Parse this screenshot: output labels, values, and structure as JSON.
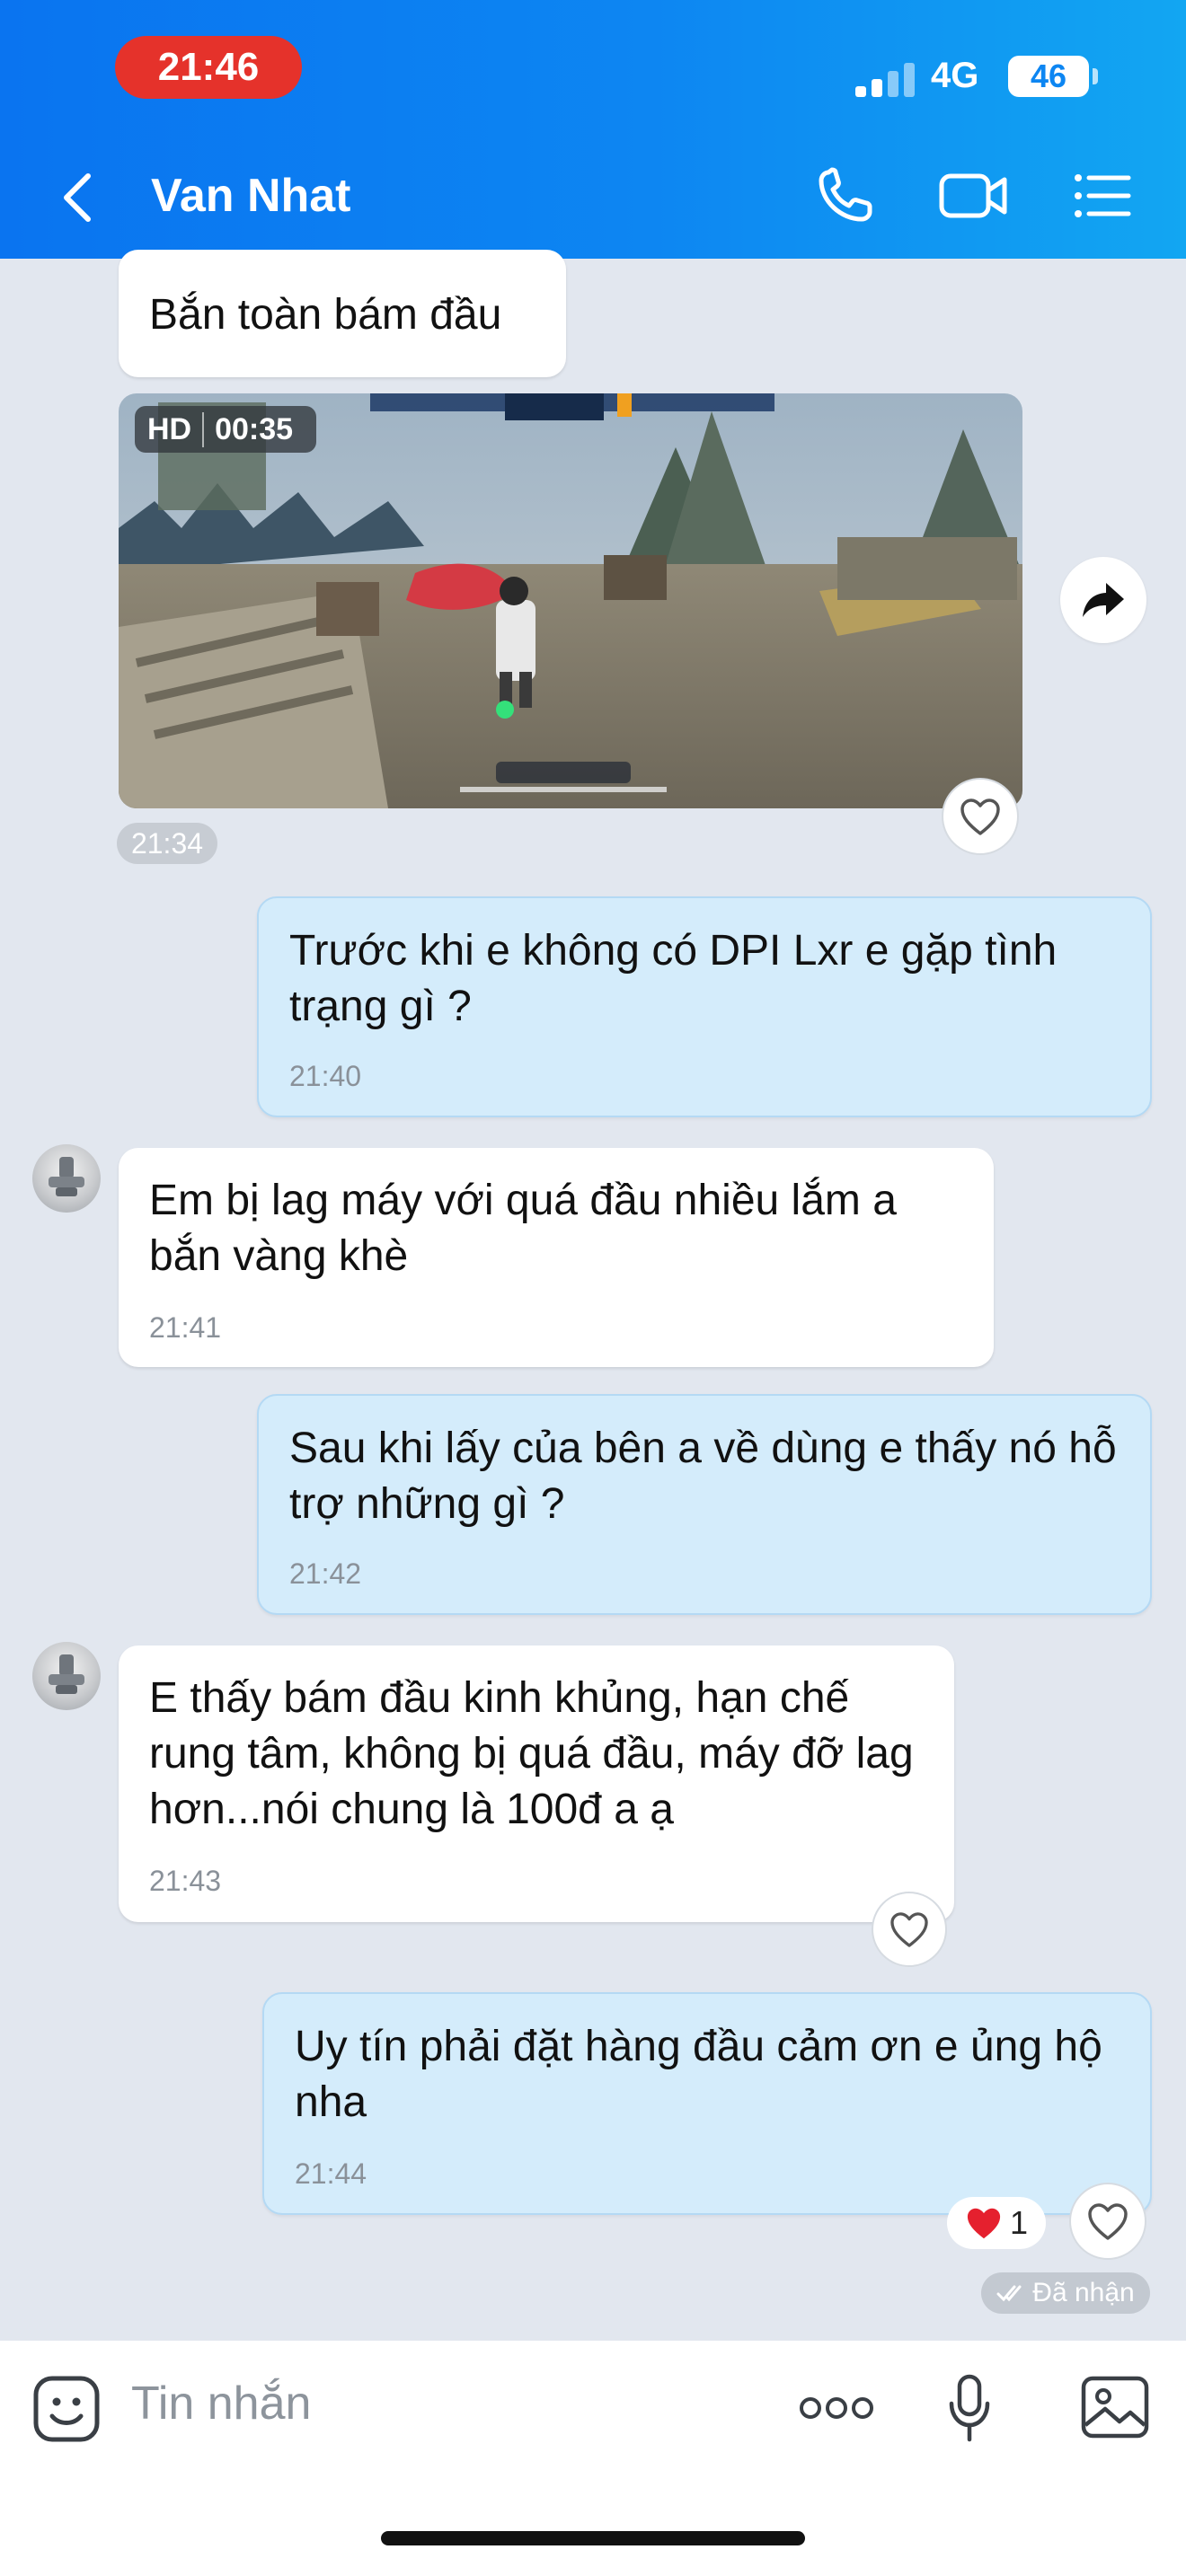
{
  "status_bar": {
    "time": "21:46",
    "network": "4G",
    "battery": "46"
  },
  "header": {
    "contact_name": "Van Nhat",
    "icons": [
      "back-icon",
      "phone-icon",
      "video-call-icon",
      "menu-list-icon"
    ]
  },
  "messages": [
    {
      "side": "in",
      "text": "Bắn toàn bám đầu",
      "time": ""
    },
    {
      "side": "in",
      "type": "video",
      "badge": "HD",
      "duration": "00:35",
      "time": "21:34"
    },
    {
      "side": "out",
      "text": "Trước khi e không có DPI Lxr e gặp tình trạng gì ?",
      "time": "21:40"
    },
    {
      "side": "in",
      "text": "Em bị lag máy với quá đầu nhiều lắm a bắn vàng khè",
      "time": "21:41"
    },
    {
      "side": "out",
      "text": "Sau khi lấy của bên a về dùng e thấy nó hỗ trợ những gì ?",
      "time": "21:42"
    },
    {
      "side": "in",
      "text": "E thấy bám đầu kinh khủng, hạn chế rung tâm, không bị quá đầu, máy đỡ lag hơn...nói chung là 100đ a ạ",
      "time": "21:43"
    },
    {
      "side": "out",
      "text": "Uy tín phải đặt hàng đầu cảm ơn e ủng hộ nha",
      "time": "21:44"
    }
  ],
  "reaction": {
    "emoji": "heart",
    "count": "1"
  },
  "delivery_status": "Đã nhận",
  "composer": {
    "placeholder": "Tin nhắn"
  },
  "colors": {
    "header_start": "#0a74f0",
    "header_end": "#12a6f2",
    "outgoing_bubble": "#d4ecfb",
    "incoming_bubble": "#ffffff",
    "chat_background": "#e2e7ef",
    "time_pill": "#e5322b"
  }
}
